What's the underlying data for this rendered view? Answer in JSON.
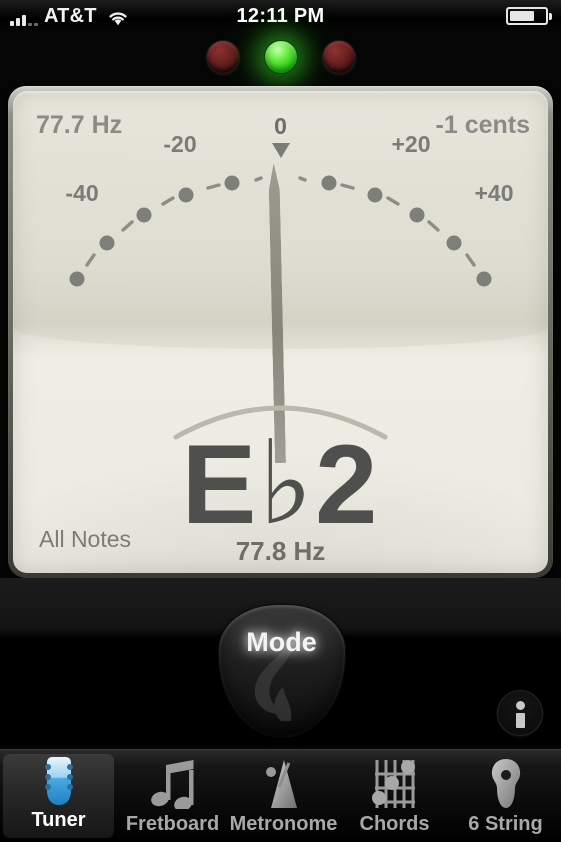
{
  "statusbar": {
    "carrier": "AT&T",
    "time": "12:11 PM",
    "signal_icon": "signal-bars-icon",
    "wifi_icon": "wifi-icon",
    "battery_icon": "battery-icon"
  },
  "leds": [
    {
      "name": "led-flat",
      "state": "off",
      "color": "#6d2322"
    },
    {
      "name": "led-in-tune",
      "state": "on",
      "color": "#3ce020"
    },
    {
      "name": "led-sharp",
      "state": "off",
      "color": "#6d2322"
    }
  ],
  "tuner": {
    "frequency_readout": "77.7 Hz",
    "cents_readout": "-1 cents",
    "center_label": "0",
    "mode_label": "All Notes",
    "note_letter": "E",
    "note_accidental": "♭",
    "note_octave": "2",
    "note_frequency": "77.8 Hz",
    "scale_labels": [
      {
        "text": "-40",
        "cents": -40
      },
      {
        "text": "-20",
        "cents": -20
      },
      {
        "text": "+20",
        "cents": 20
      },
      {
        "text": "+40",
        "cents": 40
      }
    ],
    "needle_cents": -1,
    "dial_face_color": "#e6e6dc",
    "needle_color": "#8d8d82",
    "text_color": "#8b8b85"
  },
  "controls": {
    "mode_button_label": "Mode",
    "info_button_name": "info-icon"
  },
  "tabs": [
    {
      "label": "Tuner",
      "icon": "guitar-headstock-icon",
      "active": true
    },
    {
      "label": "Fretboard",
      "icon": "music-note-icon",
      "active": false
    },
    {
      "label": "Metronome",
      "icon": "metronome-icon",
      "active": false
    },
    {
      "label": "Chords",
      "icon": "chord-diagram-icon",
      "active": false
    },
    {
      "label": "6 String",
      "icon": "guitar-body-icon",
      "active": false
    }
  ]
}
